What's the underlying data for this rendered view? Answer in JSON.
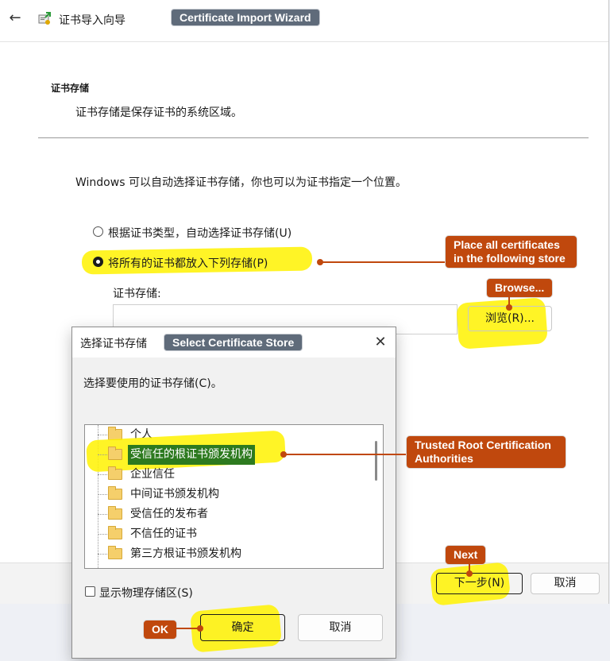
{
  "wizard": {
    "title": "证书导入向导",
    "annotation": "Certificate Import Wizard",
    "section_title": "证书存储",
    "section_desc": "证书存储是保存证书的系统区域。",
    "auto_text": "Windows 可以自动选择证书存储，你也可以为证书指定一个位置。",
    "radio_auto": "根据证书类型，自动选择证书存储(U)",
    "radio_manual": "将所有的证书都放入下列存储(P)",
    "radio_selected": "manual",
    "store_label": "证书存储:",
    "store_value": "",
    "browse_button": "浏览(R)...",
    "next_button": "下一步(N)",
    "cancel_button": "取消"
  },
  "dialog": {
    "title": "选择证书存储",
    "annotation": "Select Certificate Store",
    "prompt": "选择要使用的证书存储(C)。",
    "stores": [
      "个人",
      "受信任的根证书颁发机构",
      "企业信任",
      "中间证书颁发机构",
      "受信任的发布者",
      "不信任的证书",
      "第三方根证书颁发机构"
    ],
    "selected_store": "受信任的根证书颁发机构",
    "show_physical": "显示物理存储区(S)",
    "ok_button": "确定",
    "cancel_button": "取消"
  },
  "callouts": {
    "place_all_line1": "Place all certificates",
    "place_all_line2": "in the following store",
    "browse": "Browse...",
    "trusted_line1": "Trusted Root Certification",
    "trusted_line2": "Authorities",
    "next": "Next",
    "ok": "OK"
  },
  "colors": {
    "annotation_gray": "#5f6b7a",
    "callout_orange": "#c0480d",
    "highlight_yellow": "#fff200",
    "selected_green": "#2d7a1f"
  },
  "icons": {
    "back": "arrow-left-icon",
    "wizard": "certificate-icon",
    "close": "close-icon",
    "folder": "folder-icon"
  }
}
